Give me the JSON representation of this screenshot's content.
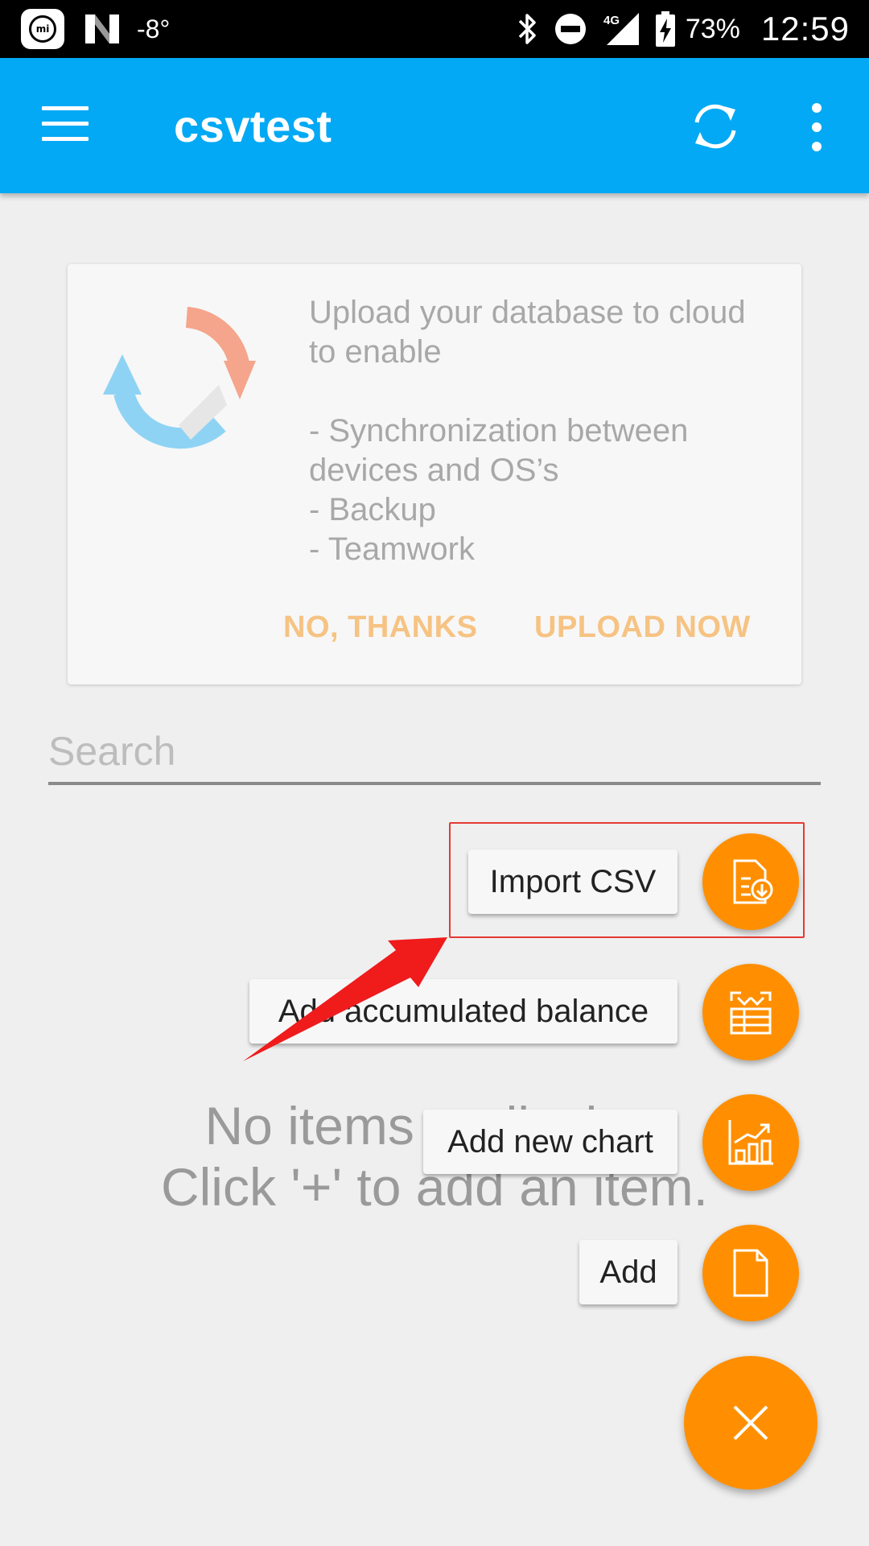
{
  "status_bar": {
    "temperature": "-8°",
    "network": "4G",
    "battery": "73%",
    "time": "12:59"
  },
  "app_bar": {
    "title": "csvtest"
  },
  "upload_card": {
    "line1": "Upload your database to cloud",
    "line2": "to enable",
    "bullets": [
      "- Synchronization between",
      "devices and OS’s",
      "- Backup",
      "- Teamwork"
    ],
    "no_thanks_label": "NO, THANKS",
    "upload_now_label": "UPLOAD NOW"
  },
  "search": {
    "placeholder": "Search",
    "value": ""
  },
  "empty_state": {
    "line1": "No items to display.",
    "line2": "Click '+' to add an item."
  },
  "fab_menu": {
    "items": [
      {
        "label": "Import CSV",
        "icon": "import-csv-icon"
      },
      {
        "label": "Add accumulated balance",
        "icon": "accumulated-balance-icon"
      },
      {
        "label": "Add new chart",
        "icon": "chart-icon"
      },
      {
        "label": "Add",
        "icon": "document-icon"
      }
    ],
    "main_icon": "close-icon"
  },
  "colors": {
    "app_bar": "#03a9f4",
    "accent": "#ff8f00",
    "card_button": "#f6c383",
    "annotation": "#e53935"
  }
}
